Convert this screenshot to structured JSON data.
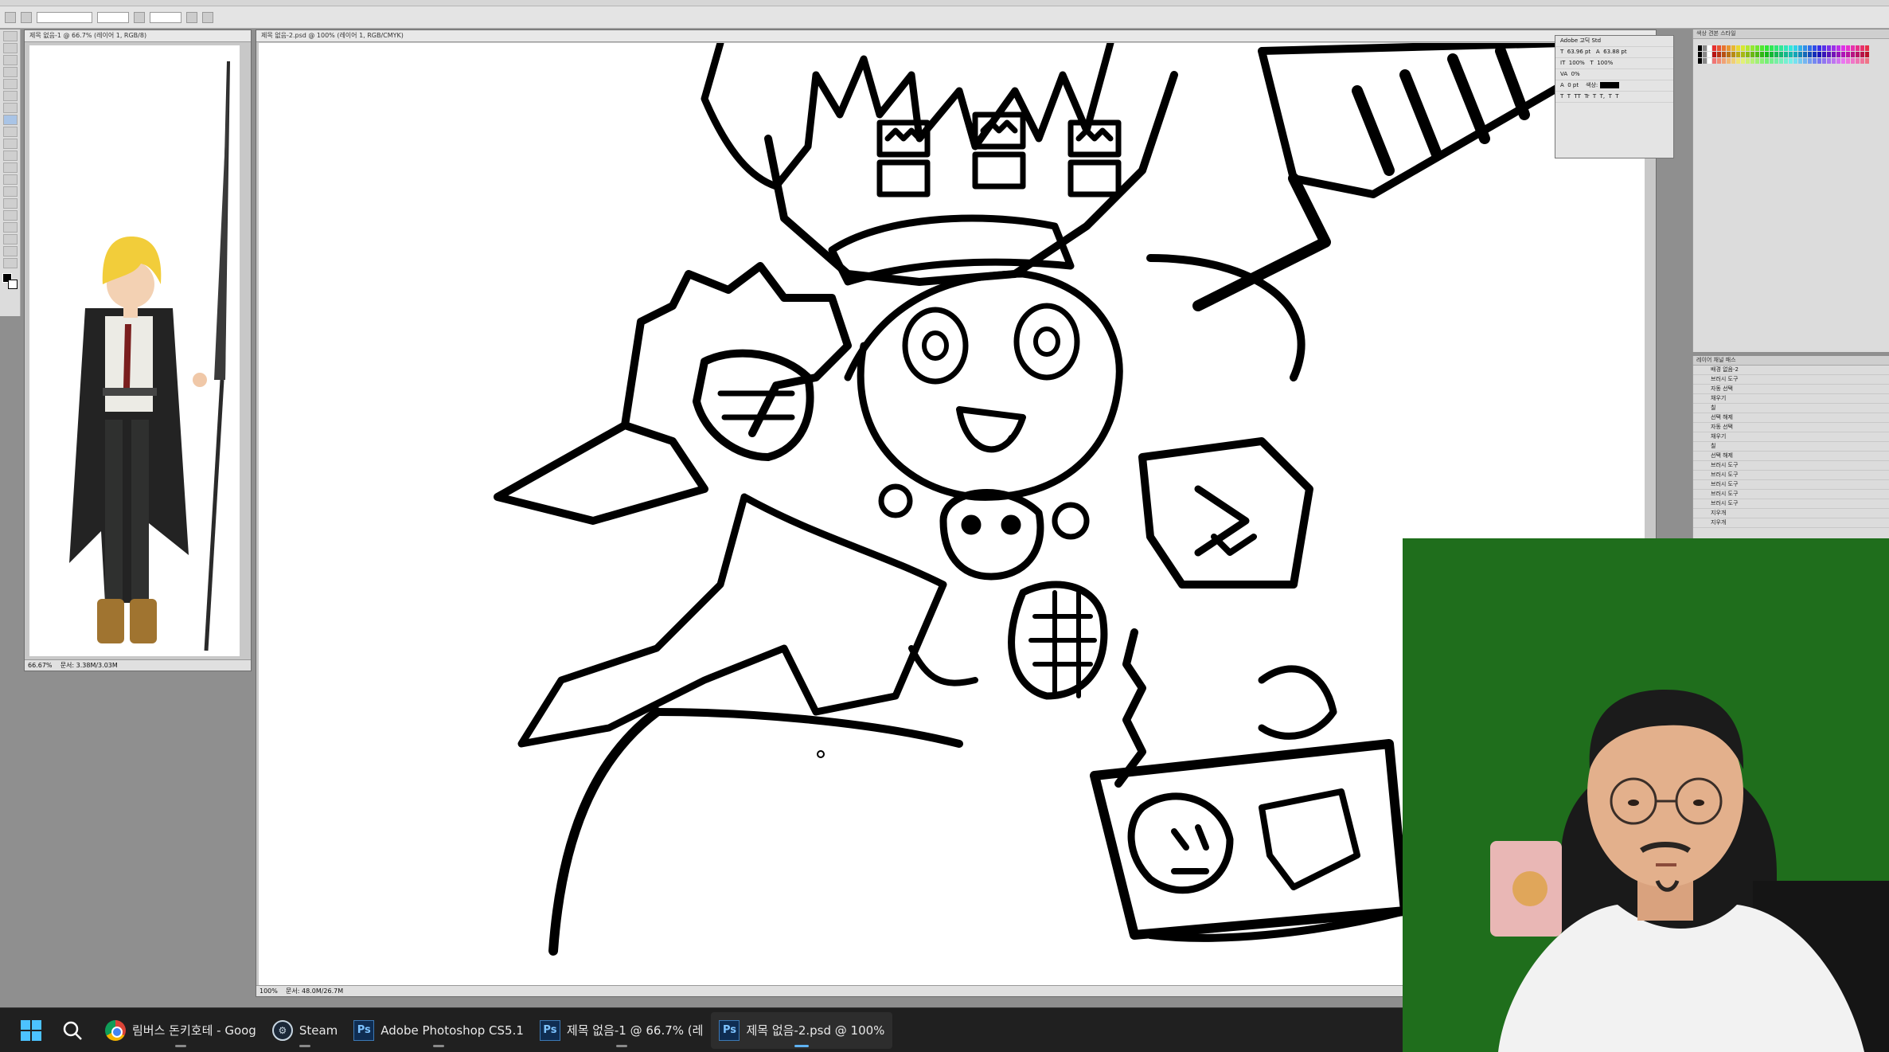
{
  "documents": {
    "reference": {
      "title": "제목 없음-1 @ 66.7% (레이어 1, RGB/8)",
      "zoom": "66.67%",
      "status": "문서: 3.38M/3.03M"
    },
    "main": {
      "title": "제목 없음-2.psd @ 100% (레이어 1, RGB/CMYK)",
      "zoom": "100%",
      "status": "문서: 48.0M/26.7M"
    }
  },
  "panels": {
    "character": {
      "font": "Adobe 고딕 Std",
      "size": "63.96 pt",
      "leading": "63.88 pt",
      "scale_v": "100%",
      "scale_h": "100%",
      "tracking": "0%",
      "baseline": "0 pt",
      "color_label": "색상:"
    },
    "layers": {
      "tabs": "레이어  채널  패스",
      "items": [
        "배경 없음-2",
        "브러시 도구",
        "자동 선택",
        "채우기",
        "칠",
        "선택 해제",
        "자동 선택",
        "채우기",
        "칠",
        "선택 해제",
        "브러시 도구",
        "브러시 도구",
        "브러시 도구",
        "브러시 도구",
        "브러시 도구",
        "지우개",
        "지우개"
      ]
    },
    "swatches_tab": "색상  견본  스타일"
  },
  "taskbar": {
    "apps": [
      {
        "label": "림버스 돈키호테 - Goog",
        "icon": "chrome-icon",
        "active": false
      },
      {
        "label": "Steam",
        "icon": "steam-icon",
        "active": false
      },
      {
        "label": "Adobe Photoshop CS5.1",
        "icon": "photoshop-icon",
        "active": false
      },
      {
        "label": "제목 없음-1 @ 66.7% (레",
        "icon": "photoshop-icon",
        "active": false
      },
      {
        "label": "제목 없음-2.psd @ 100%",
        "icon": "photoshop-icon",
        "active": true
      }
    ]
  },
  "colors": {
    "webcam_bg": "#1f6e1c",
    "taskbar_bg": "#202020",
    "workspace": "#8f8f8f",
    "accent": "#5fb2f2"
  }
}
